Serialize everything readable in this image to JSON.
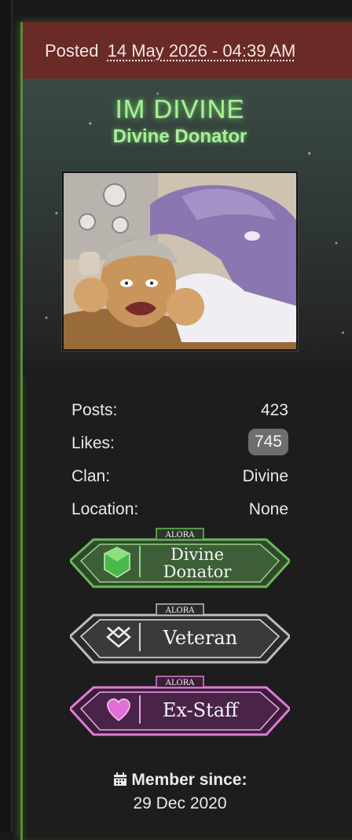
{
  "post": {
    "posted_label": "Posted",
    "date": "14 May 2026 - 04:39 AM"
  },
  "user": {
    "name": "IM DIVINE",
    "rank": "Divine Donator"
  },
  "stats": [
    {
      "label": "Posts:",
      "value": "423"
    },
    {
      "label": "Likes:",
      "value": "745"
    },
    {
      "label": "Clan:",
      "value": "Divine"
    },
    {
      "label": "Location:",
      "value": "None"
    }
  ],
  "badges": [
    {
      "tag": "ALORA",
      "line1": "Divine",
      "line2": "Donator",
      "color": "#4a8a3a",
      "icon": "gem-icon"
    },
    {
      "tag": "ALORA",
      "line1": "Veteran",
      "color": "#9a9a9a",
      "icon": "veteran-emblem-icon"
    },
    {
      "tag": "ALORA",
      "line1": "Ex-Staff",
      "color": "#d070c8",
      "icon": "heart-icon"
    }
  ],
  "member": {
    "label": "Member since:",
    "date": "29 Dec 2020"
  },
  "colors": {
    "header_bg": "#6a2a26",
    "name_glow": "#a8f09a",
    "card_border": "#5a8a3a"
  }
}
